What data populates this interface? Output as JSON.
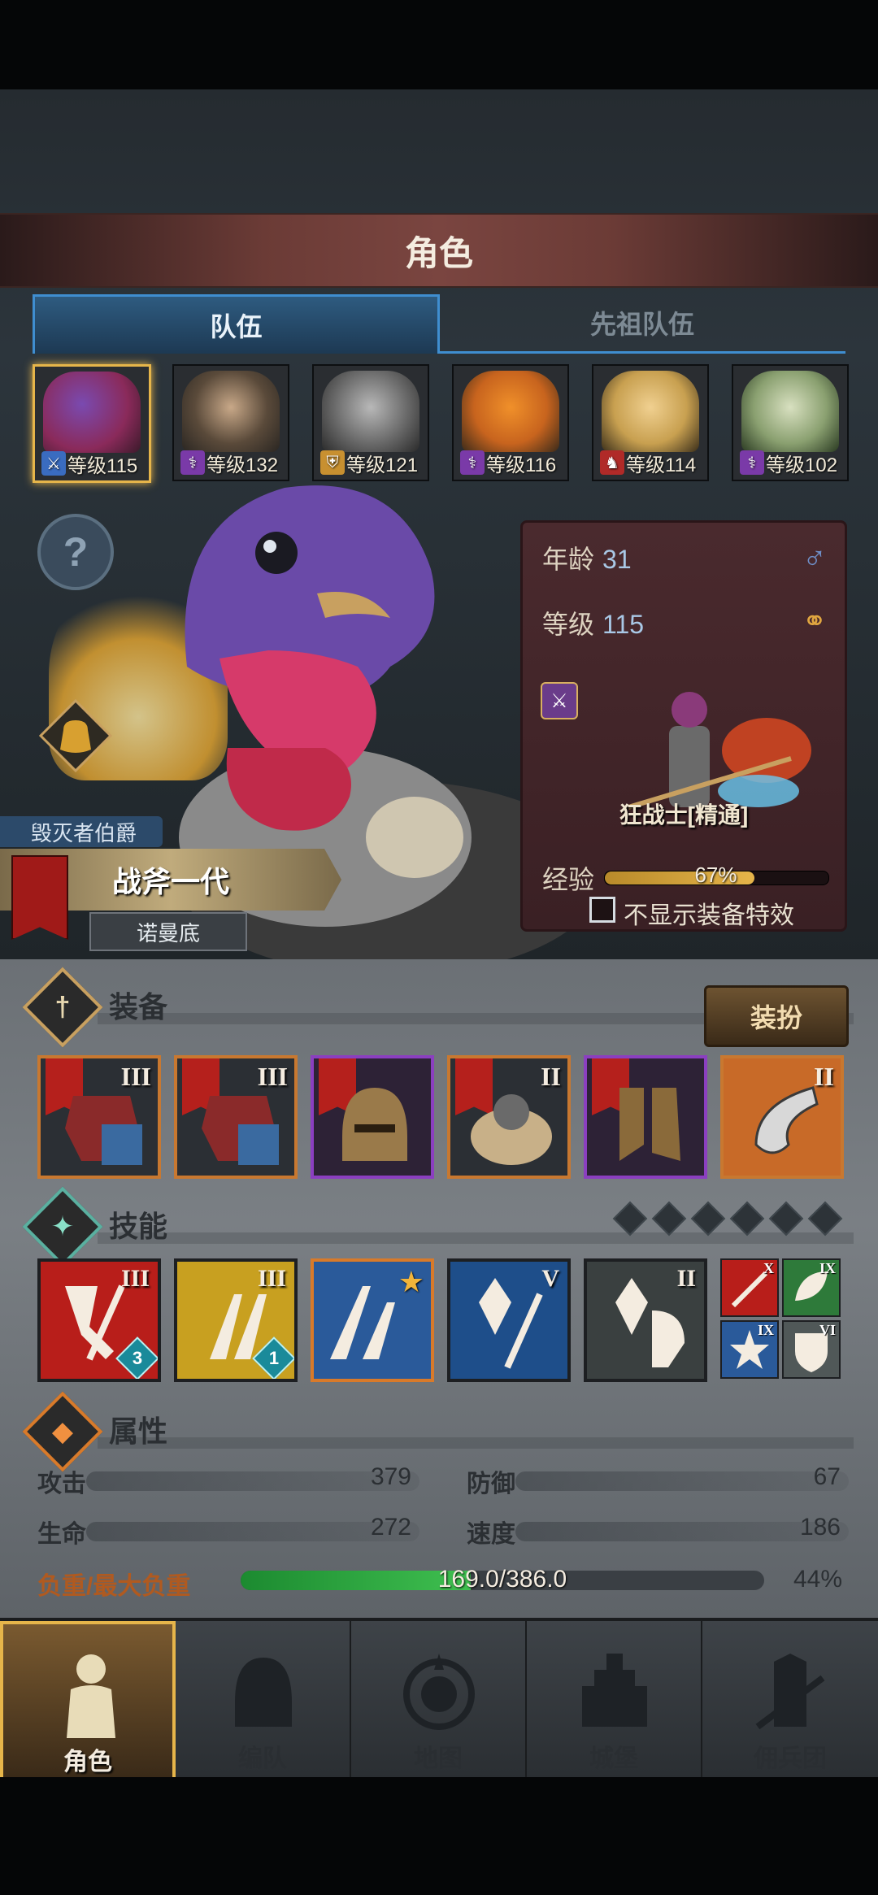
{
  "header": {
    "title": "角色"
  },
  "tabs": [
    {
      "label": "队伍",
      "active": true
    },
    {
      "label": "先祖队伍",
      "active": false
    }
  ],
  "heroes": [
    {
      "level_label": "等级115",
      "class_color": "#3a6cc0",
      "portrait_color": "#8a3a7a",
      "active": true
    },
    {
      "level_label": "等级132",
      "class_color": "#7a3aa8",
      "portrait_color": "#6a5a4a",
      "active": false
    },
    {
      "level_label": "等级121",
      "class_color": "#c89030",
      "portrait_color": "#7a7a7a",
      "active": false
    },
    {
      "level_label": "等级116",
      "class_color": "#7a3aa8",
      "portrait_color": "#c8641e",
      "active": false
    },
    {
      "level_label": "等级114",
      "class_color": "#b02a28",
      "portrait_color": "#c8a050",
      "active": false
    },
    {
      "level_label": "等级102",
      "class_color": "#7a3aa8",
      "portrait_color": "#8aa070",
      "active": false
    }
  ],
  "character": {
    "title": "毁灭者伯爵",
    "name": "战斧一代",
    "origin": "诺曼底",
    "age_label": "年龄",
    "age": "31",
    "level_label": "等级",
    "level": "115",
    "class_name": "狂战士[精通]",
    "exp_label": "经验",
    "exp_percent": "67%",
    "hide_fx_label": "不显示装备特效"
  },
  "equipment": {
    "section_title": "装备",
    "dress_button": "装扮",
    "items": [
      {
        "tier": "III",
        "rarity": "orange",
        "has_flag": true,
        "art": "armor-icon"
      },
      {
        "tier": "III",
        "rarity": "orange",
        "has_flag": true,
        "art": "armor-icon"
      },
      {
        "tier": "",
        "rarity": "purple",
        "has_flag": true,
        "art": "helmet-icon"
      },
      {
        "tier": "II",
        "rarity": "orange",
        "has_flag": true,
        "art": "fur-armor-icon"
      },
      {
        "tier": "",
        "rarity": "purple",
        "has_flag": true,
        "art": "boots-icon"
      },
      {
        "tier": "II",
        "rarity": "orange",
        "has_flag": false,
        "art": "horn-icon"
      }
    ]
  },
  "skills": {
    "section_title": "技能",
    "slots": 6,
    "main": [
      {
        "tier": "III",
        "bg": "#b81e1a",
        "gem": "3",
        "star": false,
        "orange": false
      },
      {
        "tier": "III",
        "bg": "#c8a020",
        "gem": "1",
        "star": false,
        "orange": false
      },
      {
        "tier": "",
        "bg": "#2a5a9a",
        "gem": "",
        "star": true,
        "orange": true
      },
      {
        "tier": "V",
        "bg": "#1e4e8a",
        "gem": "",
        "star": false,
        "orange": false
      },
      {
        "tier": "II",
        "bg": "#3a4040",
        "gem": "",
        "star": false,
        "orange": false
      }
    ],
    "mini": [
      {
        "tier": "X",
        "bg": "#b81e1a"
      },
      {
        "tier": "IX",
        "bg": "#2e7a3a"
      },
      {
        "tier": "IX",
        "bg": "#2a5a9a"
      },
      {
        "tier": "VI",
        "bg": "#505858"
      }
    ]
  },
  "attributes": {
    "section_title": "属性",
    "attack_label": "攻击",
    "attack": "379",
    "defense_label": "防御",
    "defense": "67",
    "health_label": "生命",
    "health": "272",
    "speed_label": "速度",
    "speed": "186",
    "load_label": "负重/最大负重",
    "load_value": "169.0/386.0",
    "load_percent": "44%"
  },
  "nav": [
    {
      "label": "角色",
      "icon": "knight-icon",
      "active": true
    },
    {
      "label": "编队",
      "icon": "helmet-icon",
      "active": false
    },
    {
      "label": "地图",
      "icon": "compass-icon",
      "active": false
    },
    {
      "label": "城堡",
      "icon": "castle-icon",
      "active": false
    },
    {
      "label": "佣兵团",
      "icon": "mercenary-icon",
      "active": false
    }
  ]
}
